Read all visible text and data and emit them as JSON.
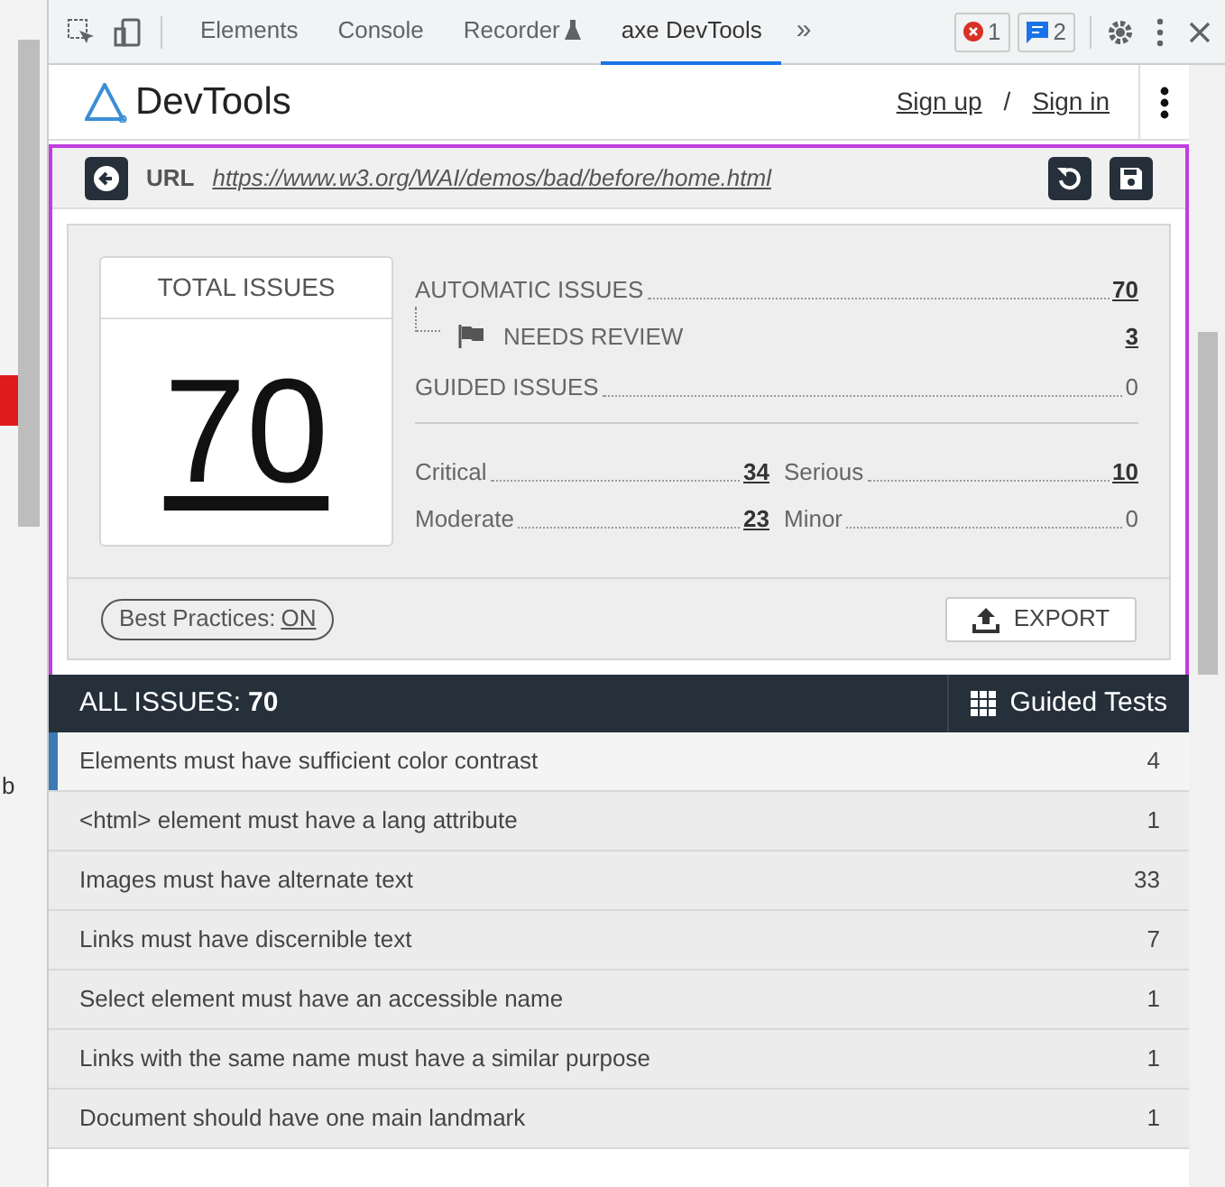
{
  "devtools_tabs": [
    {
      "label": "Elements",
      "selected": false
    },
    {
      "label": "Console",
      "selected": false
    },
    {
      "label": "Recorder",
      "selected": false
    },
    {
      "label": "axe DevTools",
      "selected": true
    }
  ],
  "more_tabs": "»",
  "error_count": "1",
  "message_count": "2",
  "left_page_text": "b",
  "header": {
    "title": "DevTools",
    "sign_up": "Sign up",
    "separator": "/",
    "sign_in": "Sign in"
  },
  "url_bar": {
    "label": "URL",
    "url": "https://www.w3.org/WAI/demos/bad/before/home.html"
  },
  "summary": {
    "total_label": "TOTAL ISSUES",
    "total": "70",
    "automatic_label": "AUTOMATIC ISSUES",
    "automatic": "70",
    "needs_review_label": "NEEDS REVIEW",
    "needs_review": "3",
    "guided_label": "GUIDED ISSUES",
    "guided": "0",
    "severities": [
      {
        "label": "Critical",
        "count": "34",
        "linked": true
      },
      {
        "label": "Serious",
        "count": "10",
        "linked": true
      },
      {
        "label": "Moderate",
        "count": "23",
        "linked": true
      },
      {
        "label": "Minor",
        "count": "0",
        "linked": false
      }
    ],
    "best_practices_label": "Best Practices:",
    "best_practices_value": "ON",
    "export_label": "EXPORT"
  },
  "issues_bar": {
    "label": "ALL ISSUES:",
    "count": "70",
    "guided_tests": "Guided Tests"
  },
  "issues": [
    {
      "name": "Elements must have sufficient color contrast",
      "count": "4",
      "selected": true
    },
    {
      "name": "<html> element must have a lang attribute",
      "count": "1",
      "selected": false
    },
    {
      "name": "Images must have alternate text",
      "count": "33",
      "selected": false
    },
    {
      "name": "Links must have discernible text",
      "count": "7",
      "selected": false
    },
    {
      "name": "Select element must have an accessible name",
      "count": "1",
      "selected": false
    },
    {
      "name": "Links with the same name must have a similar purpose",
      "count": "1",
      "selected": false
    },
    {
      "name": "Document should have one main landmark",
      "count": "1",
      "selected": false
    }
  ]
}
